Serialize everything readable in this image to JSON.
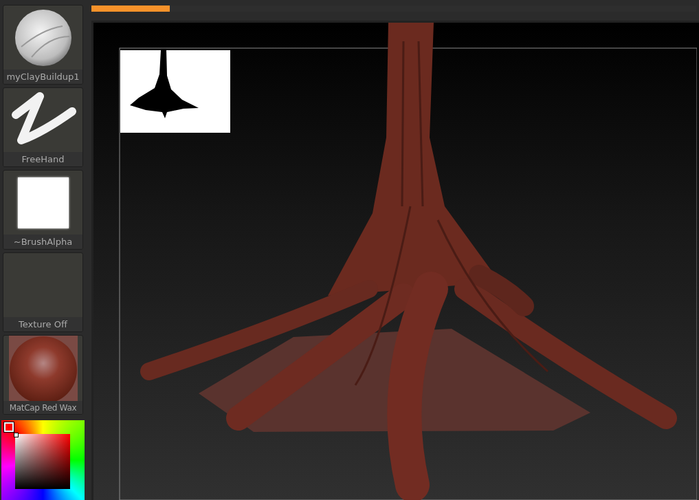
{
  "tool_tiles": [
    {
      "kind": "brush",
      "label": "myClayBuildup1"
    },
    {
      "kind": "stroke",
      "label": "FreeHand"
    },
    {
      "kind": "alpha",
      "label": "~BrushAlpha"
    },
    {
      "kind": "texture",
      "label": "Texture Off"
    },
    {
      "kind": "material",
      "label": "MatCap Red Wax"
    }
  ],
  "color_picker": {
    "color": "#ff0000"
  },
  "progress": {
    "level": 0.13
  }
}
